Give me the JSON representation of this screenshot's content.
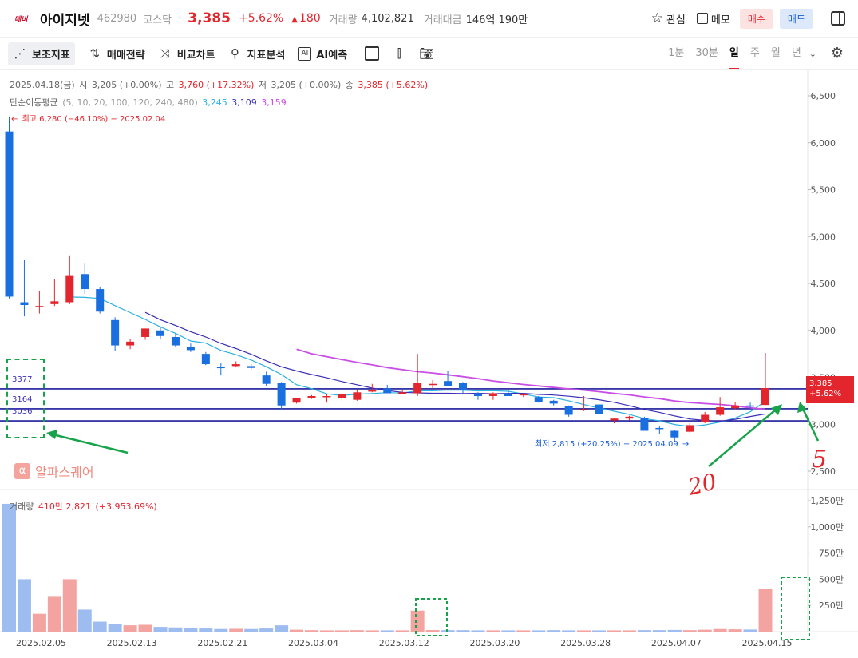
{
  "header": {
    "logo_text": "메비",
    "name": "아이지넷",
    "code": "462980",
    "market": "코스닥",
    "separator": "·",
    "price": "3,385",
    "change_pct": "+5.62%",
    "change": "180",
    "volume_label": "거래량",
    "volume": "4,102,821",
    "amount_label": "거래대금",
    "amount": "146억 190만",
    "watch_label": "관심",
    "memo_label": "메모",
    "buy_label": "매수",
    "sell_label": "매도"
  },
  "toolbar": {
    "tools": [
      "보조지표",
      "매매전략",
      "비교차트",
      "지표분석",
      "AI예측"
    ],
    "periods": [
      "1분",
      "30분",
      "일",
      "주",
      "월",
      "년"
    ],
    "active_period": "일"
  },
  "info": {
    "date": "2025.04.18(금)",
    "open_label": "시",
    "open": "3,205 (+0.00%)",
    "high_label": "고",
    "high": "3,760 (+17.32%)",
    "low_label": "저",
    "low": "3,205 (+0.00%)",
    "close_label": "종",
    "close": "3,385 (+5.62%)",
    "ma_label": "단순이동평균",
    "ma_params": "(5, 10, 20, 100, 120, 240, 480)",
    "ma5": "3,245",
    "ma10": "3,109",
    "ma20": "3,159",
    "volume_label": "거래량",
    "volume_value": "410만 2,821",
    "volume_change": "(+3,953.69%)"
  },
  "annotations": {
    "max_label": "최고 6,280 (−46.10%) − 2025.02.04",
    "min_label": "최저 2,815 (+20.25%) − 2025.04.09",
    "watermark": "알파스퀘어",
    "levels": [
      "3377",
      "3164",
      "3036"
    ],
    "handwritten": [
      "20",
      "5"
    ],
    "last_price_tag": "3,385",
    "last_pct_tag": "+5.62%"
  },
  "colors": {
    "up": "#e3262d",
    "down": "#1a6fe0",
    "ma5": "#2ab1e0",
    "ma10": "#3b2fb8",
    "ma20": "#c94ee6",
    "hline": "#1c1c9c",
    "annot_green": "#16a34a"
  },
  "chart_data": [
    {
      "type": "candlestick",
      "title": "",
      "ylim": [
        2300,
        6700
      ],
      "yticks": [
        "6,500",
        "6,000",
        "5,500",
        "5,000",
        "4,500",
        "4,000",
        "3,500",
        "3,000",
        "2,500"
      ],
      "ytick_values": [
        6500,
        6000,
        5500,
        5000,
        4500,
        4000,
        3500,
        3000,
        2500
      ],
      "xtick_labels": [
        "2025.02.05",
        "2025.02.13",
        "2025.02.21",
        "2025.03.04",
        "2025.03.12",
        "2025.03.20",
        "2025.03.28",
        "2025.04.07",
        "2025.04.15"
      ],
      "xtick_index": [
        1,
        7,
        13,
        19,
        25,
        31,
        37,
        43,
        49
      ],
      "ohlc": [
        [
          6120,
          6280,
          4340,
          4360
        ],
        [
          4300,
          4750,
          4150,
          4270
        ],
        [
          4250,
          4420,
          4180,
          4260
        ],
        [
          4280,
          4550,
          4260,
          4310
        ],
        [
          4300,
          4800,
          4280,
          4580
        ],
        [
          4600,
          4720,
          4390,
          4440
        ],
        [
          4440,
          4460,
          4180,
          4200
        ],
        [
          4110,
          4140,
          3780,
          3840
        ],
        [
          3840,
          3910,
          3800,
          3880
        ],
        [
          3930,
          4020,
          3900,
          4020
        ],
        [
          4000,
          4030,
          3910,
          3940
        ],
        [
          3930,
          3970,
          3820,
          3840
        ],
        [
          3820,
          3860,
          3770,
          3790
        ],
        [
          3750,
          3770,
          3630,
          3640
        ],
        [
          3610,
          3650,
          3520,
          3600
        ],
        [
          3620,
          3670,
          3610,
          3640
        ],
        [
          3620,
          3640,
          3580,
          3600
        ],
        [
          3520,
          3560,
          3410,
          3430
        ],
        [
          3440,
          3450,
          3150,
          3200
        ],
        [
          3230,
          3280,
          3220,
          3280
        ],
        [
          3280,
          3310,
          3270,
          3300
        ],
        [
          3290,
          3320,
          3230,
          3300
        ],
        [
          3280,
          3330,
          3250,
          3320
        ],
        [
          3260,
          3370,
          3250,
          3340
        ],
        [
          3350,
          3430,
          3340,
          3360
        ],
        [
          3380,
          3420,
          3350,
          3330
        ],
        [
          3320,
          3360,
          3320,
          3340
        ],
        [
          3330,
          3750,
          3300,
          3440
        ],
        [
          3420,
          3470,
          3380,
          3430
        ],
        [
          3460,
          3570,
          3410,
          3410
        ],
        [
          3440,
          3450,
          3330,
          3360
        ],
        [
          3330,
          3340,
          3260,
          3300
        ],
        [
          3300,
          3340,
          3260,
          3330
        ],
        [
          3330,
          3360,
          3300,
          3300
        ],
        [
          3310,
          3330,
          3290,
          3320
        ],
        [
          3290,
          3300,
          3230,
          3240
        ],
        [
          3250,
          3260,
          3200,
          3220
        ],
        [
          3190,
          3200,
          3080,
          3100
        ],
        [
          3150,
          3300,
          3140,
          3160
        ],
        [
          3210,
          3230,
          3100,
          3110
        ],
        [
          3040,
          3060,
          3010,
          3060
        ],
        [
          3060,
          3090,
          3040,
          3080
        ],
        [
          3070,
          3080,
          2930,
          2930
        ],
        [
          2960,
          2980,
          2900,
          2950
        ],
        [
          2930,
          2940,
          2815,
          2860
        ],
        [
          2920,
          3010,
          2910,
          2990
        ],
        [
          3020,
          3130,
          3010,
          3100
        ],
        [
          3100,
          3290,
          3090,
          3180
        ],
        [
          3170,
          3240,
          3160,
          3200
        ],
        [
          3200,
          3230,
          3170,
          3190
        ],
        [
          3205,
          3760,
          3205,
          3385
        ]
      ],
      "ma5": [
        null,
        null,
        null,
        null,
        4356,
        4352,
        4340,
        4263,
        4189,
        4117,
        4037,
        3969,
        3887,
        3864,
        3787,
        3741,
        3685,
        3613,
        3530,
        3421,
        3379,
        3324,
        3306,
        3320,
        3327,
        3337,
        3332,
        3356,
        3356,
        3364,
        3363,
        3355,
        3357,
        3351,
        3322,
        3290,
        3283,
        3250,
        3209,
        3172,
        3138,
        3105,
        3059,
        3036,
        2997,
        2975,
        2993,
        3023,
        3065,
        3132,
        3245
      ],
      "ma10": [
        null,
        null,
        null,
        null,
        null,
        null,
        null,
        null,
        null,
        4192,
        4114,
        4052,
        3986,
        3930,
        3862,
        3806,
        3745,
        3676,
        3612,
        3568,
        3530,
        3495,
        3455,
        3421,
        3385,
        3359,
        3340,
        3334,
        3330,
        3330,
        3327,
        3330,
        3325,
        3329,
        3329,
        3318,
        3311,
        3298,
        3282,
        3261,
        3234,
        3197,
        3157,
        3126,
        3088,
        3056,
        3040,
        3032,
        3052,
        3082,
        3109
      ],
      "ma20": [
        null,
        null,
        null,
        null,
        null,
        null,
        null,
        null,
        null,
        null,
        null,
        null,
        null,
        null,
        null,
        null,
        null,
        null,
        null,
        3799,
        3751,
        3720,
        3689,
        3659,
        3633,
        3604,
        3582,
        3560,
        3546,
        3527,
        3507,
        3486,
        3461,
        3442,
        3423,
        3408,
        3392,
        3377,
        3363,
        3347,
        3328,
        3313,
        3291,
        3273,
        3247,
        3231,
        3220,
        3211,
        3196,
        3175,
        3159
      ],
      "hlines": [
        3377,
        3164,
        3036
      ],
      "max_point": {
        "index": 0,
        "value": 6280,
        "date": "2025.02.04"
      },
      "min_point": {
        "index": 44,
        "value": 2815,
        "date": "2025.04.09"
      },
      "last_price": 3385
    },
    {
      "type": "bar",
      "title": "거래량",
      "ylim": [
        0,
        1350
      ],
      "yticks": [
        "1,250만",
        "1,000만",
        "750만",
        "500만",
        "250만"
      ],
      "ytick_values": [
        1250,
        1000,
        750,
        500,
        250
      ],
      "values_unit": "만",
      "values": [
        1220,
        500,
        170,
        340,
        500,
        210,
        95,
        70,
        60,
        65,
        45,
        40,
        32,
        30,
        25,
        27,
        25,
        30,
        60,
        18,
        14,
        12,
        12,
        14,
        12,
        12,
        12,
        200,
        15,
        14,
        14,
        12,
        12,
        12,
        12,
        12,
        14,
        12,
        12,
        12,
        12,
        12,
        14,
        14,
        16,
        14,
        18,
        25,
        22,
        20,
        410
      ]
    }
  ]
}
